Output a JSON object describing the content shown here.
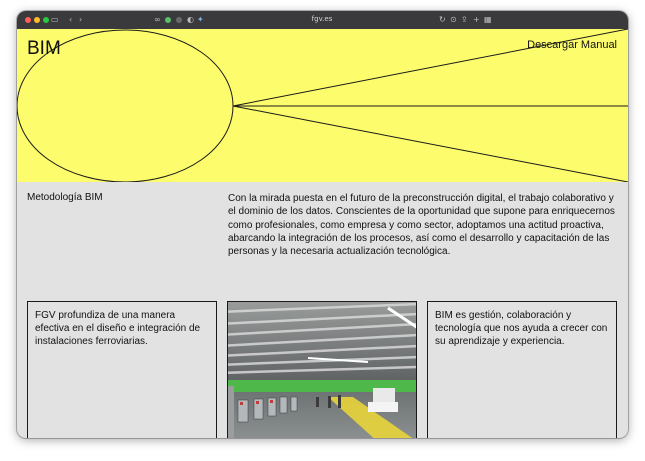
{
  "browser": {
    "url": "fgv.es"
  },
  "header": {
    "brand": "BIM",
    "download_label": "Descargar Manual"
  },
  "intro": {
    "label": "Metodología BIM",
    "text": "Con la mirada puesta en el futuro de la preconstrucción digital, el trabajo colaborativo y el dominio de los datos. Conscientes de la oportunidad que supone para enriquecernos como profesionales, como empresa y como sector, adoptamos una actitud proactiva, abarcando la integración de los procesos, así como el desarrollo y capacitación de las personas y la necesaria actualización tecnológica."
  },
  "cards": [
    {
      "text": "FGV profundiza de una manera efectiva en el diseño e integración de instalaciones ferroviarias."
    },
    {
      "image": "metro-station-photo"
    },
    {
      "text": "BIM es gestión, colaboración y tecnología que nos ayuda a crecer con su aprendizaje y experiencia."
    }
  ],
  "colors": {
    "hero_yellow": "#fcfc6c",
    "page_gray": "#e2e2e2",
    "text": "#111111"
  }
}
